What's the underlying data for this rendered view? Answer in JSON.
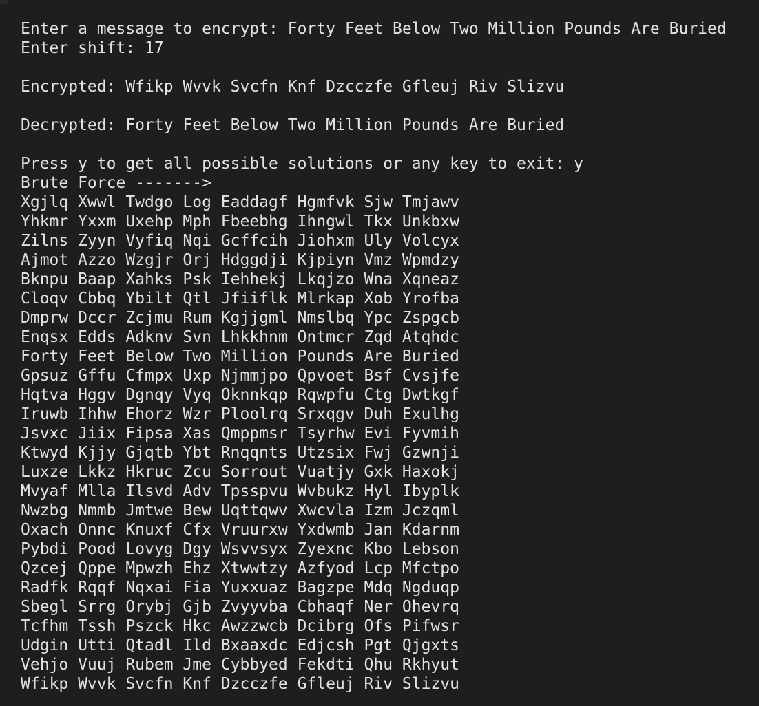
{
  "colors": {
    "background": "#1e1e1e",
    "text": "#e2e2e2"
  },
  "session": {
    "prompt_message_label": "Enter a message to encrypt: ",
    "input_message": "Forty Feet Below Two Million Pounds Are Buried",
    "prompt_shift_label": "Enter shift: ",
    "input_shift": "17",
    "encrypted_label": "Encrypted: ",
    "encrypted_value": "Wfikp Wvvk Svcfn Knf Dzcczfe Gfleuj Riv Slizvu",
    "decrypted_label": "Decrypted: ",
    "decrypted_value": "Forty Feet Below Two Million Pounds Are Buried",
    "prompt_continue_label": "Press y to get all possible solutions or any key to exit: ",
    "input_continue": "y",
    "brute_force_header": "Brute Force ------->"
  },
  "brute_force_results": [
    "Xgjlq Xwwl Twdgo Log Eaddagf Hgmfvk Sjw Tmjawv",
    "Yhkmr Yxxm Uxehp Mph Fbeebhg Ihngwl Tkx Unkbxw",
    "Zilns Zyyn Vyfiq Nqi Gcffcih Jiohxm Uly Volcyx",
    "Ajmot Azzo Wzgjr Orj Hdggdji Kjpiyn Vmz Wpmdzy",
    "Bknpu Baap Xahks Psk Iehhekj Lkqjzo Wna Xqneaz",
    "Cloqv Cbbq Ybilt Qtl Jfiiflk Mlrkap Xob Yrofba",
    "Dmprw Dccr Zcjmu Rum Kgjjgml Nmslbq Ypc Zspgcb",
    "Enqsx Edds Adknv Svn Lhkkhnm Ontmcr Zqd Atqhdc",
    "Forty Feet Below Two Million Pounds Are Buried",
    "Gpsuz Gffu Cfmpx Uxp Njmmjpo Qpvoet Bsf Cvsjfe",
    "Hqtva Hggv Dgnqy Vyq Oknnkqp Rqwpfu Ctg Dwtkgf",
    "Iruwb Ihhw Ehorz Wzr Ploolrq Srxqgv Duh Exulhg",
    "Jsvxc Jiix Fipsa Xas Qmppmsr Tsyrhw Evi Fyvmih",
    "Ktwyd Kjjy Gjqtb Ybt Rnqqnts Utzsix Fwj Gzwnji",
    "Luxze Lkkz Hkruc Zcu Sorrout Vuatjy Gxk Haxokj",
    "Mvyaf Mlla Ilsvd Adv Tpsspvu Wvbukz Hyl Ibyplk",
    "Nwzbg Nmmb Jmtwe Bew Uqttqwv Xwcvla Izm Jczqml",
    "Oxach Onnc Knuxf Cfx Vruurxw Yxdwmb Jan Kdarnm",
    "Pybdi Pood Lovyg Dgy Wsvvsyx Zyexnc Kbo Lebson",
    "Qzcej Qppe Mpwzh Ehz Xtwwtzy Azfyod Lcp Mfctpo",
    "Radfk Rqqf Nqxai Fia Yuxxuaz Bagzpe Mdq Ngduqp",
    "Sbegl Srrg Orybj Gjb Zvyyvba Cbhaqf Ner Ohevrq",
    "Tcfhm Tssh Pszck Hkc Awzzwcb Dcibrg Ofs Pifwsr",
    "Udgin Utti Qtadl Ild Bxaaxdc Edjcsh Pgt Qjgxts",
    "Vehjo Vuuj Rubem Jme Cybbyed Fekdti Qhu Rkhyut",
    "Wfikp Wvvk Svcfn Knf Dzcczfe Gfleuj Riv Slizvu"
  ]
}
